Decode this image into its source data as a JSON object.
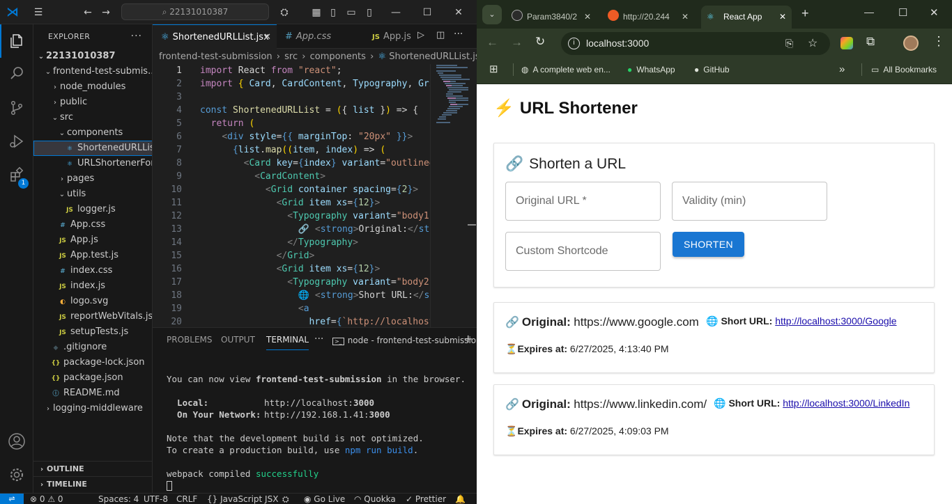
{
  "vscode": {
    "search_text": "22131010387",
    "explorer_title": "EXPLORER",
    "extensions_badge": "1",
    "tree": [
      {
        "label": "22131010387",
        "kind": "root",
        "chev": "⌄"
      },
      {
        "label": "frontend-test-submis...",
        "kind": "folder",
        "chev": "⌄"
      },
      {
        "label": "node_modules",
        "kind": "folder",
        "chev": "›"
      },
      {
        "label": "public",
        "kind": "folder",
        "chev": "›"
      },
      {
        "label": "src",
        "kind": "folder",
        "chev": "⌄"
      },
      {
        "label": "components",
        "kind": "folder",
        "chev": "⌄"
      },
      {
        "label": "ShortenedURLList...",
        "kind": "react",
        "chev": ""
      },
      {
        "label": "URLShortenerFor...",
        "kind": "react",
        "chev": ""
      },
      {
        "label": "pages",
        "kind": "folder",
        "chev": "›"
      },
      {
        "label": "utils",
        "kind": "folder",
        "chev": "⌄"
      },
      {
        "label": "logger.js",
        "kind": "js",
        "chev": ""
      },
      {
        "label": "App.css",
        "kind": "css",
        "chev": ""
      },
      {
        "label": "App.js",
        "kind": "js",
        "chev": ""
      },
      {
        "label": "App.test.js",
        "kind": "js",
        "chev": ""
      },
      {
        "label": "index.css",
        "kind": "css",
        "chev": ""
      },
      {
        "label": "index.js",
        "kind": "js",
        "chev": ""
      },
      {
        "label": "logo.svg",
        "kind": "svg",
        "chev": ""
      },
      {
        "label": "reportWebVitals.js",
        "kind": "js",
        "chev": ""
      },
      {
        "label": "setupTests.js",
        "kind": "js",
        "chev": ""
      },
      {
        "label": ".gitignore",
        "kind": "git",
        "chev": ""
      },
      {
        "label": "package-lock.json",
        "kind": "json",
        "chev": ""
      },
      {
        "label": "package.json",
        "kind": "json",
        "chev": ""
      },
      {
        "label": "README.md",
        "kind": "info",
        "chev": ""
      },
      {
        "label": "logging-middleware",
        "kind": "folder",
        "chev": "›"
      }
    ],
    "outline_label": "OUTLINE",
    "timeline_label": "TIMELINE",
    "tabs": [
      "ShortenedURLList.jsx",
      "App.css",
      "App.js"
    ],
    "breadcrumb": [
      "frontend-test-submission",
      "src",
      "components",
      "ShortenedURLList.jsx"
    ],
    "line_numbers": [
      "1",
      "2",
      "3",
      "4",
      "5",
      "6",
      "7",
      "8",
      "9",
      "10",
      "11",
      "12",
      "13",
      "14",
      "15",
      "16",
      "17",
      "18",
      "19",
      "20"
    ],
    "code_lines": [
      [
        [
          "k",
          "import "
        ],
        [
          "w",
          "React "
        ],
        [
          "k",
          "from "
        ],
        [
          "s",
          "\"react\""
        ],
        [
          "w",
          ";"
        ]
      ],
      [
        [
          "k",
          "import "
        ],
        [
          "y",
          "{ "
        ],
        [
          "v",
          "Card"
        ],
        [
          "w",
          ", "
        ],
        [
          "v",
          "CardContent"
        ],
        [
          "w",
          ", "
        ],
        [
          "v",
          "Typography"
        ],
        [
          "w",
          ", "
        ],
        [
          "v",
          "Gri"
        ]
      ],
      [],
      [
        [
          "tag",
          "const "
        ],
        [
          "f",
          "ShortenedURLList "
        ],
        [
          "w",
          "= "
        ],
        [
          "y",
          "("
        ],
        [
          "w",
          "{ "
        ],
        [
          "v",
          "list "
        ],
        [
          "w",
          "}"
        ],
        [
          "y",
          ")"
        ],
        [
          "w",
          " => {"
        ]
      ],
      [
        [
          "w",
          "  "
        ],
        [
          "k",
          "return "
        ],
        [
          "y",
          "("
        ]
      ],
      [
        [
          "w",
          "    "
        ],
        [
          "p",
          "<"
        ],
        [
          "tag",
          "div "
        ],
        [
          "v",
          "style"
        ],
        [
          "w",
          "="
        ],
        [
          "tag",
          "{{ "
        ],
        [
          "v",
          "marginTop"
        ],
        [
          "w",
          ": "
        ],
        [
          "s",
          "\"20px\" "
        ],
        [
          "tag",
          "}}"
        ],
        [
          "p",
          ">"
        ]
      ],
      [
        [
          "w",
          "      "
        ],
        [
          "tag",
          "{"
        ],
        [
          "v",
          "list"
        ],
        [
          "w",
          "."
        ],
        [
          "f",
          "map"
        ],
        [
          "y",
          "(("
        ],
        [
          "v",
          "item"
        ],
        [
          "w",
          ", "
        ],
        [
          "v",
          "index"
        ],
        [
          "y",
          ")"
        ],
        [
          "w",
          " => "
        ],
        [
          "y",
          "("
        ]
      ],
      [
        [
          "w",
          "        "
        ],
        [
          "p",
          "<"
        ],
        [
          "t",
          "Card "
        ],
        [
          "v",
          "key"
        ],
        [
          "w",
          "="
        ],
        [
          "tag",
          "{"
        ],
        [
          "v",
          "index"
        ],
        [
          "tag",
          "} "
        ],
        [
          "v",
          "variant"
        ],
        [
          "w",
          "="
        ],
        [
          "s",
          "\"outlined"
        ]
      ],
      [
        [
          "w",
          "          "
        ],
        [
          "p",
          "<"
        ],
        [
          "t",
          "CardContent"
        ],
        [
          "p",
          ">"
        ]
      ],
      [
        [
          "w",
          "            "
        ],
        [
          "p",
          "<"
        ],
        [
          "t",
          "Grid "
        ],
        [
          "v",
          "container "
        ],
        [
          "v",
          "spacing"
        ],
        [
          "w",
          "="
        ],
        [
          "tag",
          "{"
        ],
        [
          "n",
          "2"
        ],
        [
          "tag",
          "}"
        ],
        [
          "p",
          ">"
        ]
      ],
      [
        [
          "w",
          "              "
        ],
        [
          "p",
          "<"
        ],
        [
          "t",
          "Grid "
        ],
        [
          "v",
          "item "
        ],
        [
          "v",
          "xs"
        ],
        [
          "w",
          "="
        ],
        [
          "tag",
          "{"
        ],
        [
          "n",
          "12"
        ],
        [
          "tag",
          "}"
        ],
        [
          "p",
          ">"
        ]
      ],
      [
        [
          "w",
          "                "
        ],
        [
          "p",
          "<"
        ],
        [
          "t",
          "Typography "
        ],
        [
          "v",
          "variant"
        ],
        [
          "w",
          "="
        ],
        [
          "s",
          "\"body1\""
        ]
      ],
      [
        [
          "w",
          "                  🔗 "
        ],
        [
          "p",
          "<"
        ],
        [
          "tag",
          "strong"
        ],
        [
          "p",
          ">"
        ],
        [
          "w",
          "Original:"
        ],
        [
          "p",
          "</"
        ],
        [
          "tag",
          "str"
        ]
      ],
      [
        [
          "w",
          "                "
        ],
        [
          "p",
          "</"
        ],
        [
          "t",
          "Typography"
        ],
        [
          "p",
          ">"
        ]
      ],
      [
        [
          "w",
          "              "
        ],
        [
          "p",
          "</"
        ],
        [
          "t",
          "Grid"
        ],
        [
          "p",
          ">"
        ]
      ],
      [
        [
          "w",
          "              "
        ],
        [
          "p",
          "<"
        ],
        [
          "t",
          "Grid "
        ],
        [
          "v",
          "item "
        ],
        [
          "v",
          "xs"
        ],
        [
          "w",
          "="
        ],
        [
          "tag",
          "{"
        ],
        [
          "n",
          "12"
        ],
        [
          "tag",
          "}"
        ],
        [
          "p",
          ">"
        ]
      ],
      [
        [
          "w",
          "                "
        ],
        [
          "p",
          "<"
        ],
        [
          "t",
          "Typography "
        ],
        [
          "v",
          "variant"
        ],
        [
          "w",
          "="
        ],
        [
          "s",
          "\"body2\""
        ]
      ],
      [
        [
          "w",
          "                  🌐 "
        ],
        [
          "p",
          "<"
        ],
        [
          "tag",
          "strong"
        ],
        [
          "p",
          ">"
        ],
        [
          "w",
          "Short URL:"
        ],
        [
          "p",
          "</"
        ],
        [
          "tag",
          "st"
        ]
      ],
      [
        [
          "w",
          "                  "
        ],
        [
          "p",
          "<"
        ],
        [
          "tag",
          "a"
        ]
      ],
      [
        [
          "w",
          "                    "
        ],
        [
          "v",
          "href"
        ],
        [
          "w",
          "="
        ],
        [
          "tag",
          "{"
        ],
        [
          "s",
          "`http://localhost"
        ]
      ]
    ],
    "panel_tabs": [
      "PROBLEMS",
      "OUTPUT",
      "TERMINAL"
    ],
    "terminal_name": "node - frontend-test-submission",
    "terminal": {
      "line1_prefix": "You can now view ",
      "line1_app": "frontend-test-submission",
      "line1_suffix": " in the browser.",
      "local_label": "  Local:",
      "local_url": "http://localhost:",
      "local_port": "3000",
      "network_label": "  On Your Network:",
      "network_url": "http://192.168.1.41:",
      "network_port": "3000",
      "note1": "Note that the development build is not optimized.",
      "note2_prefix": "To create a production build, use ",
      "note2_cmd": "npm run build",
      "note2_suffix": ".",
      "compiled_prefix": "webpack compiled ",
      "compiled_word": "successfully"
    },
    "status": {
      "errors": "0",
      "warnings": "0",
      "spaces": "Spaces: 4",
      "encoding": "UTF-8",
      "eol": "CRLF",
      "language": "JavaScript JSX",
      "golive": "Go Live",
      "quokka": "Quokka",
      "prettier": "Prettier"
    }
  },
  "chrome": {
    "tabs": [
      {
        "title": "Param3840/2",
        "icon": "github-icon"
      },
      {
        "title": "http://20.244",
        "icon": "postman-icon"
      },
      {
        "title": "React App",
        "icon": "react-icon"
      }
    ],
    "url": "localhost:3000",
    "bookmarks": [
      "A complete web en...",
      "WhatsApp",
      "GitHub"
    ],
    "all_bookmarks": "All Bookmarks"
  },
  "app": {
    "title": "URL Shortener",
    "form_title": "Shorten a URL",
    "original_placeholder": "Original URL *",
    "validity_placeholder": "Validity (min)",
    "shortcode_placeholder": "Custom Shortcode",
    "shorten_button": "SHORTEN",
    "results": [
      {
        "original_label": "Original:",
        "original_url": "https://www.google.com",
        "short_label": "Short URL:",
        "short_url": "http://localhost:3000/Google",
        "expires_label": "Expires at:",
        "expires_at": "6/27/2025, 4:13:40 PM"
      },
      {
        "original_label": "Original:",
        "original_url": "https://www.linkedin.com/",
        "short_label": "Short URL:",
        "short_url": "http://localhost:3000/LinkedIn",
        "expires_label": "Expires at:",
        "expires_at": "6/27/2025, 4:09:03 PM"
      }
    ]
  },
  "colors": {
    "vscode_accent": "#0078d4",
    "chrome_theme": "#2e3a28",
    "mui_primary": "#1976d2",
    "link": "#1a0dab",
    "success": "#23d18b"
  }
}
